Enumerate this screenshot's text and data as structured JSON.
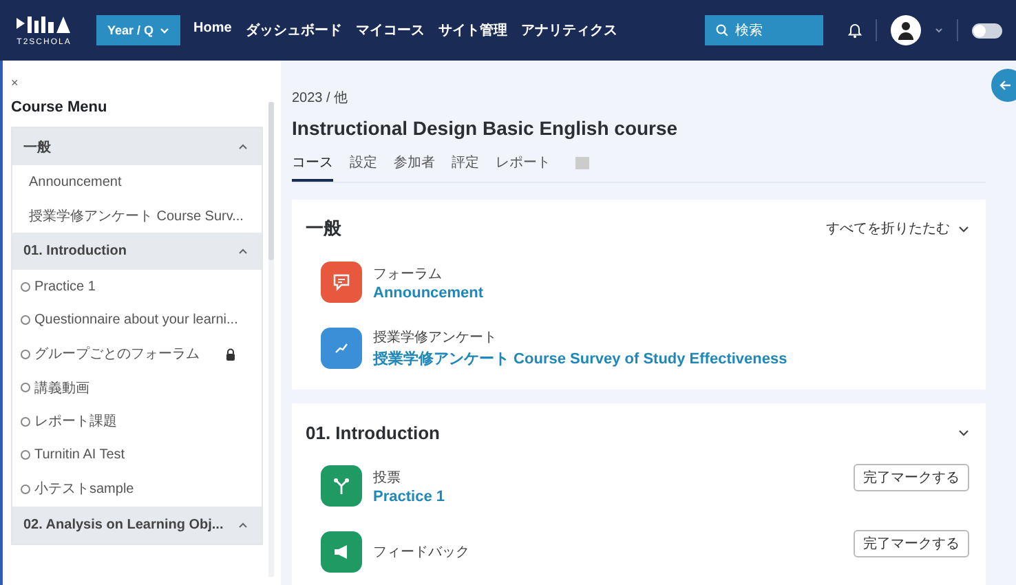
{
  "header": {
    "logo_text": "T2SCHOLA",
    "year_button": "Year / Q",
    "nav": [
      "Home",
      "ダッシュボード",
      "マイコース",
      "サイト管理",
      "アナリティクス"
    ],
    "search": {
      "placeholder": "検索"
    },
    "dark_mode": {
      "on": false
    }
  },
  "sidebar": {
    "close": "×",
    "title": "Course Menu",
    "sections": [
      {
        "title": "一般",
        "expanded": true,
        "items": [
          {
            "label": "Announcement"
          },
          {
            "label": "授業学修アンケート Course Surv..."
          }
        ]
      },
      {
        "title": "01. Introduction",
        "expanded": true,
        "items": [
          {
            "label": "Practice 1",
            "completed": false
          },
          {
            "label": "Questionnaire about your learni...",
            "completed": false
          },
          {
            "label": "グループごとのフォーラム",
            "completed": false,
            "locked": true
          },
          {
            "label": "講義動画",
            "completed": false
          },
          {
            "label": "レポート課題",
            "completed": false
          },
          {
            "label": "Turnitin AI Test",
            "completed": false
          },
          {
            "label": "小テストsample",
            "completed": false
          }
        ]
      },
      {
        "title": "02. Analysis on Learning Obj...",
        "expanded": true
      }
    ]
  },
  "breadcrumb": "2023 / 他",
  "course_title": "Instructional Design Basic English course",
  "tabs": [
    {
      "label": "コース",
      "selected": true
    },
    {
      "label": "設定",
      "selected": false
    },
    {
      "label": "参加者",
      "selected": false
    },
    {
      "label": "評定",
      "selected": false
    },
    {
      "label": "レポート",
      "selected": false
    }
  ],
  "sections": [
    {
      "title": "一般",
      "collapse_all": "すべてを折りたたむ",
      "expanded": true,
      "activities": [
        {
          "kind": "forum",
          "type": "フォーラム",
          "name": "Announcement",
          "color": "#e8583f"
        },
        {
          "kind": "survey",
          "type": "授業学修アンケート",
          "name": "授業学修アンケート Course Survey of Study Effectiveness",
          "color": "#3a8fd6"
        }
      ]
    },
    {
      "title": "01. Introduction",
      "expanded": true,
      "activities": [
        {
          "kind": "poll",
          "type": "投票",
          "name": "Practice 1",
          "color": "#1f9a63",
          "mark_button": "完了マークする"
        },
        {
          "kind": "feedback",
          "type": "フィードバック",
          "color": "#1f9a63",
          "mark_button": "完了マークする"
        }
      ]
    }
  ]
}
